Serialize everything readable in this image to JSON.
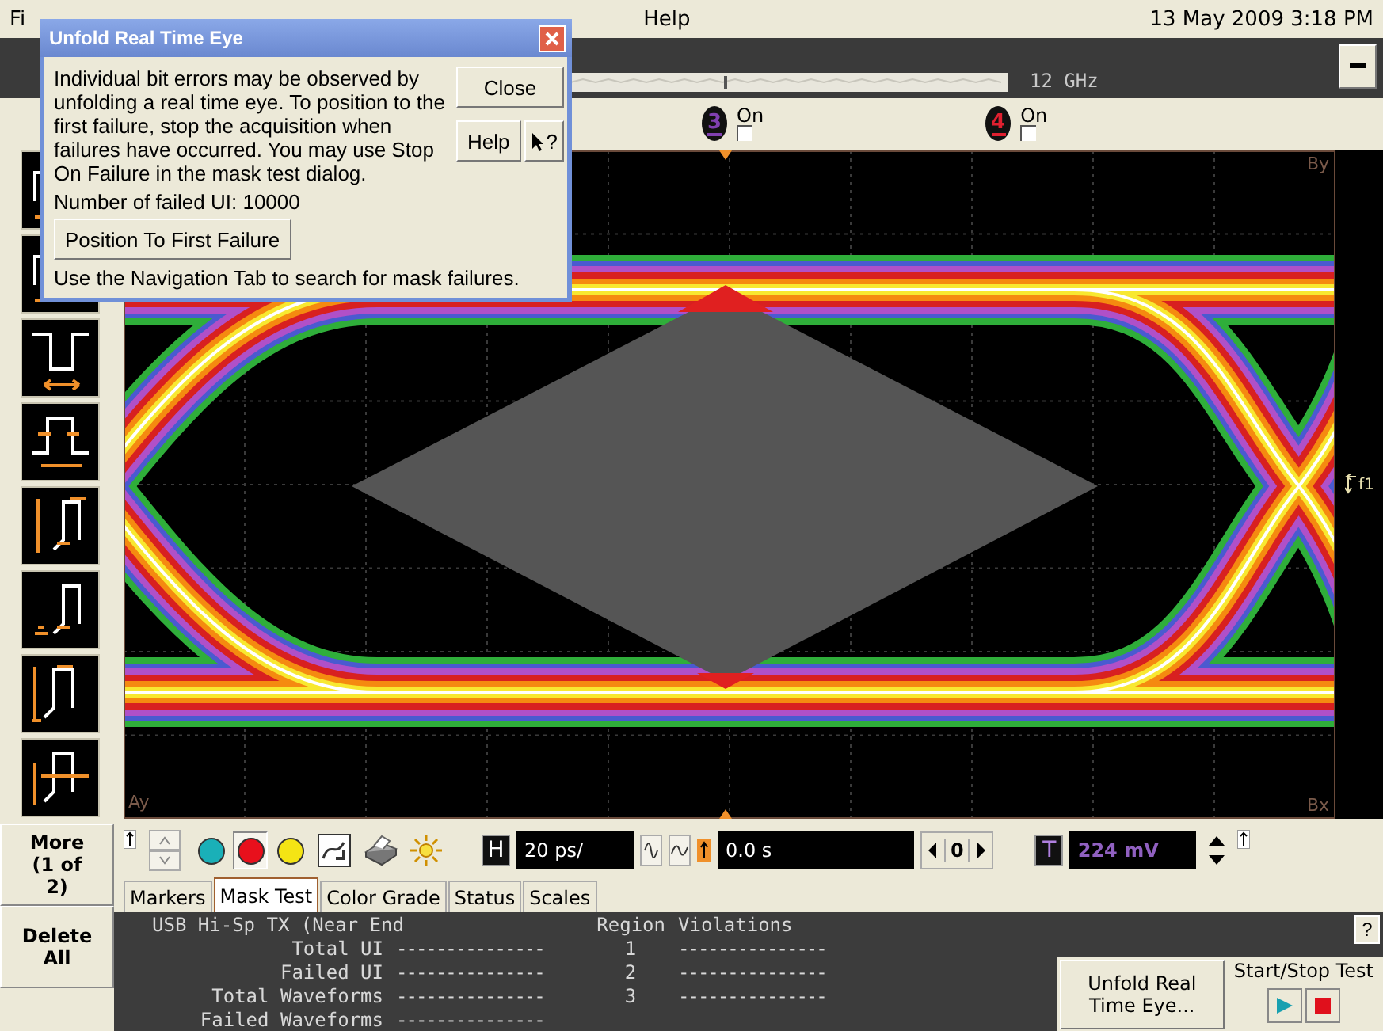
{
  "menu": [
    {
      "label": "Fi"
    },
    {
      "label": "Help"
    }
  ],
  "datetime": "13 May 2009  3:18 PM",
  "bandwidth": "12 GHz",
  "channels": [
    {
      "number": "3",
      "label": "On",
      "checked": false,
      "color": "#8040b0"
    },
    {
      "number": "4",
      "label": "On",
      "checked": false,
      "color": "#e02030"
    }
  ],
  "scope": {
    "marker_by": "By",
    "marker_ay": "Ay",
    "marker_bx": "Bx",
    "marker_f1": "f1"
  },
  "color_buttons": [
    {
      "color": "#1ab0b8",
      "selected": false
    },
    {
      "color": "#e8101c",
      "selected": true
    },
    {
      "color": "#f4e414",
      "selected": false
    }
  ],
  "horizontal": {
    "label": "H",
    "value": "20 ps/"
  },
  "delay": {
    "value": "0.0 s"
  },
  "navigation": {
    "value": "0"
  },
  "trigger": {
    "label": "T",
    "value": "224 mV"
  },
  "side_buttons": [
    "More (1 of 2)",
    "Delete All"
  ],
  "tabs": [
    {
      "label": "Markers",
      "selected": false
    },
    {
      "label": "Mask Test",
      "selected": true
    },
    {
      "label": "Color Grade",
      "selected": false
    },
    {
      "label": "Status",
      "selected": false
    },
    {
      "label": "Scales",
      "selected": false
    }
  ],
  "mask_test": {
    "title": "USB Hi-Sp TX (Near End",
    "header_region": "Region",
    "header_violations": "Violations",
    "rows": [
      {
        "label": "Total UI",
        "dashes": "---------------",
        "region": "1",
        "violations": "---------------"
      },
      {
        "label": "Failed UI",
        "dashes": "---------------",
        "region": "2",
        "violations": "---------------"
      },
      {
        "label": "Total Waveforms",
        "dashes": "---------------",
        "region": "3",
        "violations": "---------------"
      },
      {
        "label": "Failed Waveforms",
        "dashes": "---------------"
      }
    ]
  },
  "help_button": "?",
  "unfold_button": "Unfold Real Time Eye...",
  "start_stop": {
    "label": "Start/Stop Test"
  },
  "dialog": {
    "title": "Unfold Real Time Eye",
    "message": "Individual bit errors may be observed by unfolding a real time eye. To position to the first failure, stop the acquisition when failures have occurred. You may use Stop On Failure in the mask test dialog.",
    "close": "Close",
    "help": "Help",
    "whats_this": "?",
    "failed_ui": "Number of failed UI: 10000",
    "position_button": "Position To First Failure",
    "hint": "Use the Navigation Tab to search for mask failures."
  }
}
